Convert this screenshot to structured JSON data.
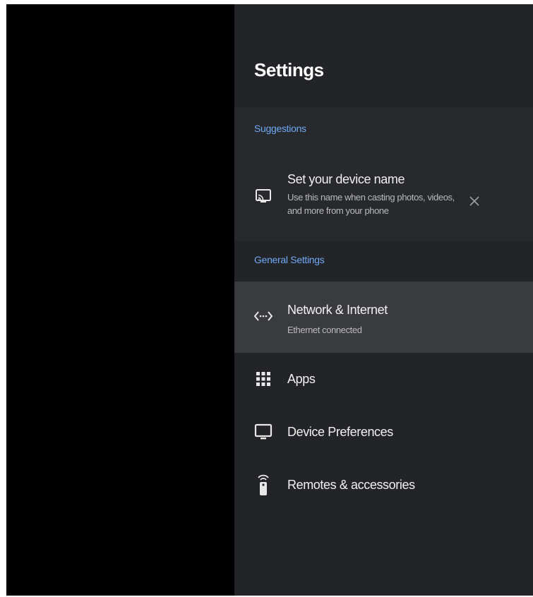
{
  "header": {
    "title": "Settings"
  },
  "sections": {
    "suggestions_label": "Suggestions",
    "general_label": "General Settings"
  },
  "suggestion": {
    "icon": "cast-icon",
    "title": "Set your device name",
    "subtitle": "Use this name when casting photos, videos, and more from your phone",
    "dismiss_icon": "close-icon"
  },
  "items": [
    {
      "icon": "network-icon",
      "title": "Network & Internet",
      "subtitle": "Ethernet connected",
      "selected": true
    },
    {
      "icon": "apps-grid-icon",
      "title": "Apps"
    },
    {
      "icon": "tv-icon",
      "title": "Device Preferences"
    },
    {
      "icon": "remote-icon",
      "title": "Remotes & accessories"
    }
  ],
  "colors": {
    "accent": "#6fa8f5",
    "panel_bg": "#232427",
    "selected_bg": "#3a3b3e"
  }
}
